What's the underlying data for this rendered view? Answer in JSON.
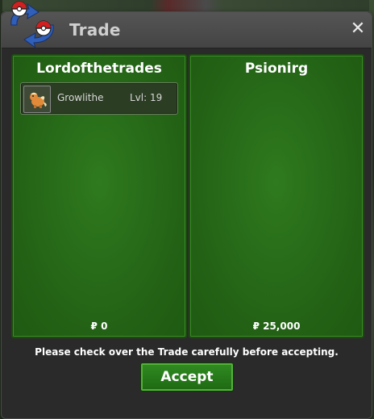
{
  "window": {
    "title": "Trade",
    "close_label": "✕"
  },
  "left_panel": {
    "player_name": "Lordofthetrades",
    "items": [
      {
        "name": "Growlithe",
        "level": "Lvl: 19",
        "icon": "growlithe-sprite-icon"
      }
    ],
    "money": "₽ 0"
  },
  "right_panel": {
    "player_name": "Psionirg",
    "items": [],
    "money": "₽ 25,000"
  },
  "footer": {
    "notice": "Please check over the Trade carefully before accepting.",
    "accept_label": "Accept"
  },
  "colors": {
    "panel_green": "#256617",
    "button_green": "#2f8a20",
    "titlebar": "#4a4a4a"
  }
}
